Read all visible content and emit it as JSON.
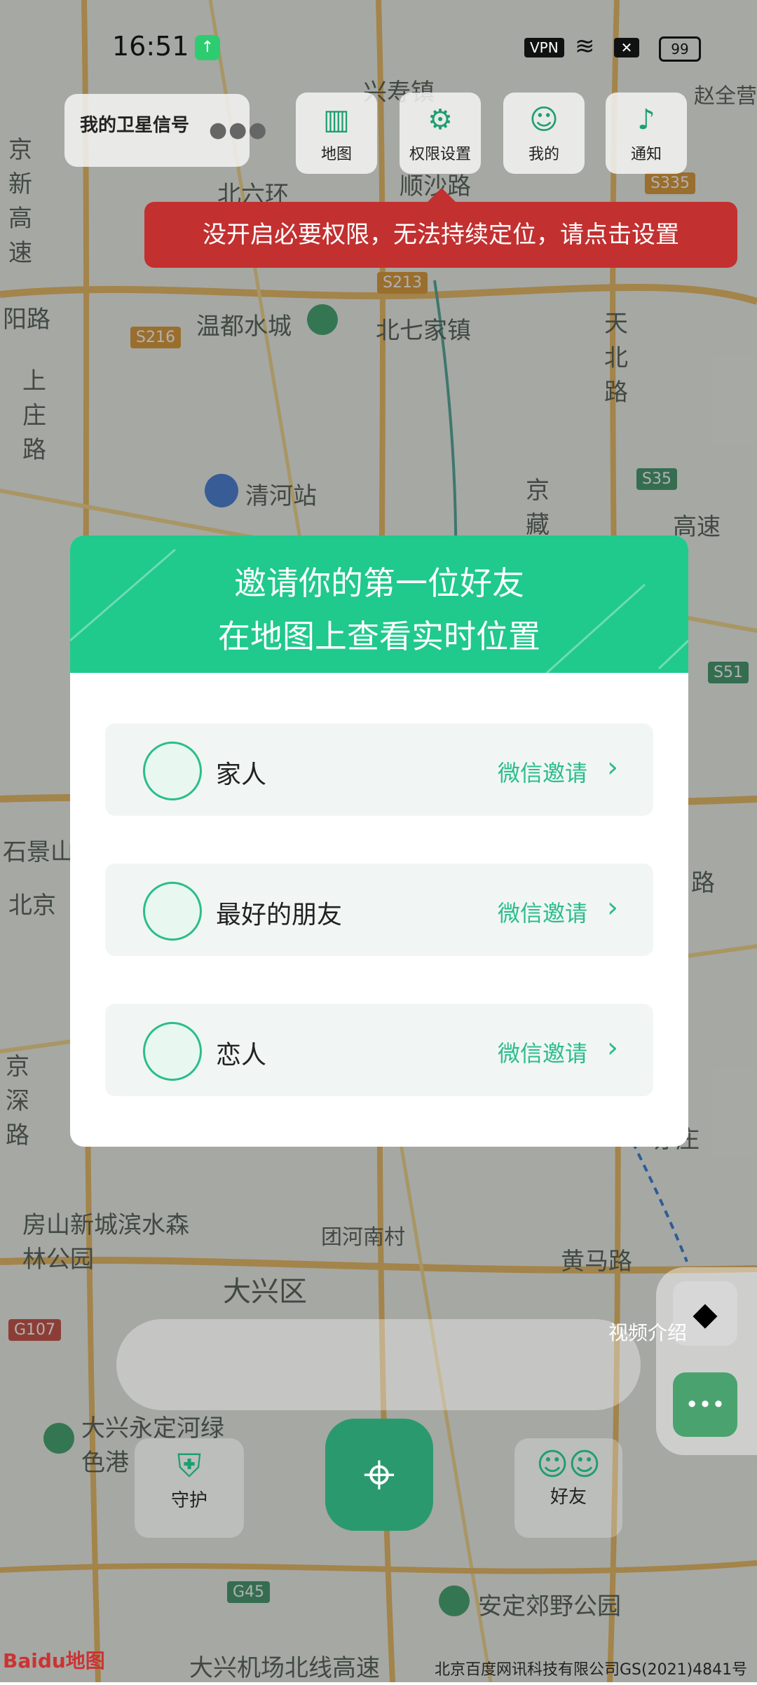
{
  "status_bar": {
    "time": "16:51",
    "vpn": "VPN",
    "battery": "99"
  },
  "satellite": {
    "label": "我的卫星信号",
    "dots": "●●●"
  },
  "top_nav": [
    {
      "label": "地图",
      "icon": "map-icon"
    },
    {
      "label": "权限设置",
      "icon": "permission-settings-icon"
    },
    {
      "label": "我的",
      "icon": "profile-icon"
    },
    {
      "label": "通知",
      "icon": "bell-icon"
    }
  ],
  "warning": {
    "text": "没开启必要权限，无法持续定位，请点击设置"
  },
  "map_labels": [
    "温都水城",
    "北七家镇",
    "清河站",
    "天北路",
    "上庄路",
    "阳路",
    "京新高速",
    "京藏",
    "高速",
    "路",
    "石景山",
    "北京",
    "京深路",
    "房山新城滨水森林公园",
    "大兴区",
    "团河南村",
    "黄马路",
    "大兴永定河绿色港",
    "亦庄",
    "安定郊野公园",
    "大兴机场北线高速",
    "顺沙路",
    "兴寿镇",
    "赵全营",
    "北六环"
  ],
  "road_tags": [
    "S216",
    "S213",
    "S35",
    "S51",
    "G107",
    "G45",
    "S335"
  ],
  "modal": {
    "title_line1": "邀请你的第一位好友",
    "title_line2": "在地图上查看实时位置",
    "rows": [
      {
        "label": "家人",
        "invite": "微信邀请",
        "chevron": "›"
      },
      {
        "label": "最好的朋友",
        "invite": "微信邀请",
        "chevron": "›"
      },
      {
        "label": "恋人",
        "invite": "微信邀请",
        "chevron": "›"
      }
    ]
  },
  "bottom": {
    "guard_label": "守护",
    "friends_label": "好友",
    "video_label": "视频介绍",
    "more_label": "•••"
  },
  "footer": {
    "baidu": "Baidu地图",
    "copyright": "北京百度网讯科技有限公司GS(2021)4841号"
  },
  "colors": {
    "accent": "#20c98c",
    "warning": "#c33030",
    "locate": "#2a9a6e"
  }
}
